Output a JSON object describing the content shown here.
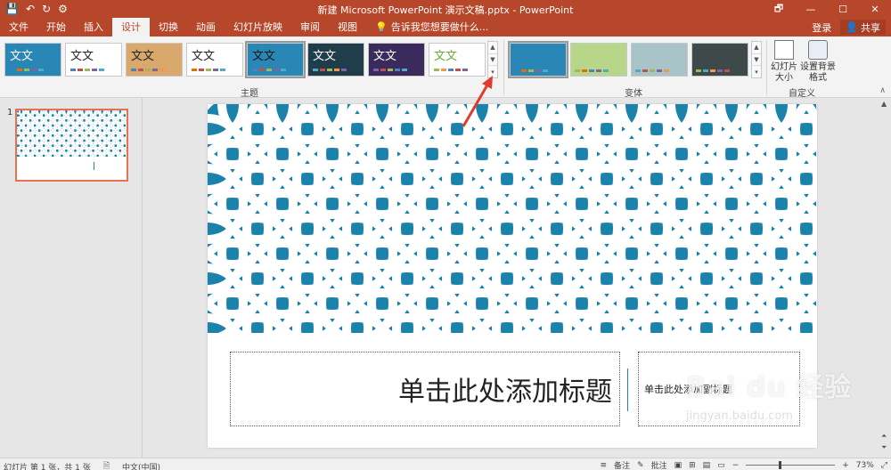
{
  "window": {
    "title": "新建 Microsoft PowerPoint 演示文稿.pptx - PowerPoint",
    "controls": [
      "🗗",
      "—",
      "☐",
      "✕"
    ]
  },
  "qat": {
    "save_icon": "save-icon",
    "undo_icon": "undo-icon",
    "redo_icon": "redo-icon",
    "customize_icon": "customize-icon"
  },
  "tabs": [
    "文件",
    "开始",
    "插入",
    "设计",
    "切换",
    "动画",
    "幻灯片放映",
    "审阅",
    "视图"
  ],
  "active_tab": "设计",
  "tell_me": "告诉我您想要做什么...",
  "account": {
    "login": "登录",
    "share": "共享"
  },
  "ribbon": {
    "themes_label": "主题",
    "variants_label": "变体",
    "customize_label": "自定义",
    "theme_text": "文文",
    "slide_size": "幻灯片大小",
    "format_background": "设置背景格式",
    "themes": [
      {
        "bg": "#2a86b4",
        "fg": "#ffffff",
        "accents": [
          "#2a86b4",
          "#e46c0a",
          "#9bbb59",
          "#8064a2",
          "#4bacc6"
        ]
      },
      {
        "bg": "#ffffff",
        "fg": "#222222",
        "accents": [
          "#4f81bd",
          "#c0504d",
          "#9bbb59",
          "#8064a2",
          "#4bacc6"
        ]
      },
      {
        "bg": "#d9a86c",
        "fg": "#222222",
        "accents": [
          "#4f81bd",
          "#c0504d",
          "#9bbb59",
          "#8064a2",
          "#f79646"
        ]
      },
      {
        "bg": "#ffffff",
        "fg": "#222222",
        "accents": [
          "#e46c0a",
          "#c0504d",
          "#9bbb59",
          "#8064a2",
          "#4bacc6"
        ]
      },
      {
        "bg": "#2a86b4",
        "fg": "#1a1a1a",
        "accents": [
          "#4f81bd",
          "#c0504d",
          "#9bbb59",
          "#8064a2",
          "#4bacc6"
        ]
      },
      {
        "bg": "#1f3d4b",
        "fg": "#ffffff",
        "accents": [
          "#4bacc6",
          "#c0504d",
          "#9bbb59",
          "#f79646",
          "#8064a2"
        ]
      },
      {
        "bg": "#3b2a5c",
        "fg": "#ffffff",
        "accents": [
          "#8064a2",
          "#c0504d",
          "#9bbb59",
          "#4f81bd",
          "#4bacc6"
        ]
      },
      {
        "bg": "#ffffff",
        "fg": "#6aa83c",
        "accents": [
          "#9bbb59",
          "#f79646",
          "#4f81bd",
          "#c0504d",
          "#8064a2"
        ]
      }
    ],
    "variants": [
      {
        "bg": "#2a86b4",
        "accents": [
          "#2a86b4",
          "#e46c0a",
          "#9bbb59",
          "#8064a2",
          "#4bacc6"
        ]
      },
      {
        "bg": "#b8d68a",
        "accents": [
          "#9bbb59",
          "#e46c0a",
          "#4f81bd",
          "#8064a2",
          "#4bacc6"
        ]
      },
      {
        "bg": "#a8c4c8",
        "accents": [
          "#4bacc6",
          "#c0504d",
          "#9bbb59",
          "#8064a2",
          "#f79646"
        ]
      },
      {
        "bg": "#3e4a4a",
        "accents": [
          "#9bbb59",
          "#4bacc6",
          "#f79646",
          "#8064a2",
          "#c0504d"
        ]
      }
    ]
  },
  "thumbs": [
    {
      "number": "1"
    }
  ],
  "slide": {
    "title_placeholder": "单击此处添加标题",
    "subtitle_placeholder": "单击此处添加副标题"
  },
  "colors": {
    "accent": "#b7472a",
    "pattern_bg": "#1a82ab",
    "pattern_fg": "#ffffff",
    "selection": "#e8714f",
    "annotation": "#e03c2e"
  },
  "watermark": {
    "line1": "Bai du 经验",
    "line2": "jingyan.baidu.com"
  },
  "status": {
    "slide_info": "幻灯片 第 1 张，共 1 张",
    "language": "中文(中国)",
    "notes": "备注",
    "comments": "批注",
    "zoom": "73%"
  }
}
